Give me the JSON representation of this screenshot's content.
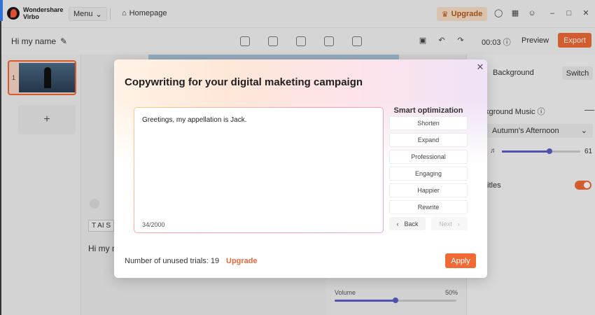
{
  "app": {
    "logo_line1": "Wondershare",
    "logo_line2": "Virbo",
    "menu_label": "Menu",
    "homepage_label": "Homepage",
    "upgrade_label": "Upgrade"
  },
  "toolbar": {
    "project_name": "Hi my name",
    "time": "00:03",
    "preview_label": "Preview",
    "export_label": "Export"
  },
  "left_panel": {
    "slide_number": "1",
    "add_label": "+"
  },
  "canvas": {
    "ai_script_label": "AI S",
    "script_preview": "Hi my n",
    "volume_label": "Volume",
    "volume_value": "50%",
    "volume_fraction": 0.5
  },
  "right_panel": {
    "background_label": "Background",
    "switch_label": "Switch",
    "music_label": "kground Music",
    "music_track": "Autumn's Afternoon",
    "music_volume": "61",
    "music_volume_fraction": 0.61,
    "subtitles_label": "titles"
  },
  "dialog": {
    "title": "Copywriting for your digital maketing campaign",
    "editor_text": "Greetings, my appellation is Jack.",
    "char_count": "34/2000",
    "smart_title": "Smart optimization",
    "options": [
      "Shorten",
      "Expand",
      "Professional",
      "Engaging",
      "Happier",
      "Rewrite"
    ],
    "back_label": "Back",
    "next_label": "Next",
    "trials_label": "Number of unused trials: 19",
    "upgrade_label": "Upgrade",
    "apply_label": "Apply"
  },
  "colors": {
    "accent": "#f06a35",
    "slider": "#5a5fc8",
    "upgrade_text": "#b45a19"
  }
}
